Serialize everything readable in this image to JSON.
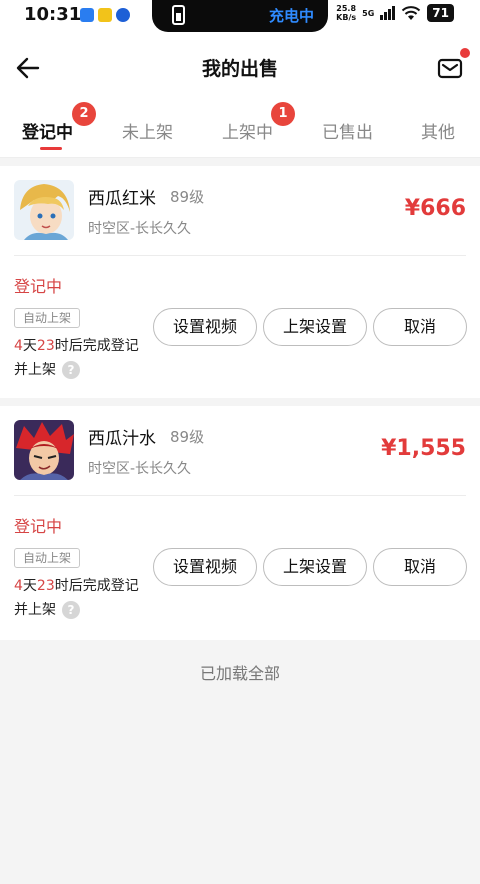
{
  "status_bar": {
    "time": "10:31",
    "charging_label": "充电中",
    "network_speed": "25.8",
    "speed_unit": "KB/s",
    "network_type": "5G",
    "battery": "71"
  },
  "header": {
    "title": "我的出售"
  },
  "tabs": [
    {
      "label": "登记中",
      "badge": "2",
      "active": true
    },
    {
      "label": "未上架"
    },
    {
      "label": "上架中",
      "badge": "1"
    },
    {
      "label": "已售出"
    },
    {
      "label": "其他"
    }
  ],
  "listings": [
    {
      "name": "西瓜红米",
      "level": "89级",
      "server": "时空区-长长久久",
      "price": "¥666",
      "status": "登记中",
      "auto_tag": "自动上架",
      "countdown": {
        "days": "4",
        "days_unit": "天",
        "hours": "23",
        "suffix": "时后完成登记并上架"
      },
      "buttons": [
        "设置视频",
        "上架设置",
        "取消"
      ]
    },
    {
      "name": "西瓜汁水",
      "level": "89级",
      "server": "时空区-长长久久",
      "price": "¥1,555",
      "status": "登记中",
      "auto_tag": "自动上架",
      "countdown": {
        "days": "4",
        "days_unit": "天",
        "hours": "23",
        "suffix": "时后完成登记并上架"
      },
      "buttons": [
        "设置视频",
        "上架设置",
        "取消"
      ]
    }
  ],
  "footer": {
    "loaded_all": "已加载全部"
  },
  "colors": {
    "accent_red": "#e23b3b",
    "status_red": "#d64545",
    "badge_red": "#e8453c",
    "charging_blue": "#2f8bff"
  }
}
